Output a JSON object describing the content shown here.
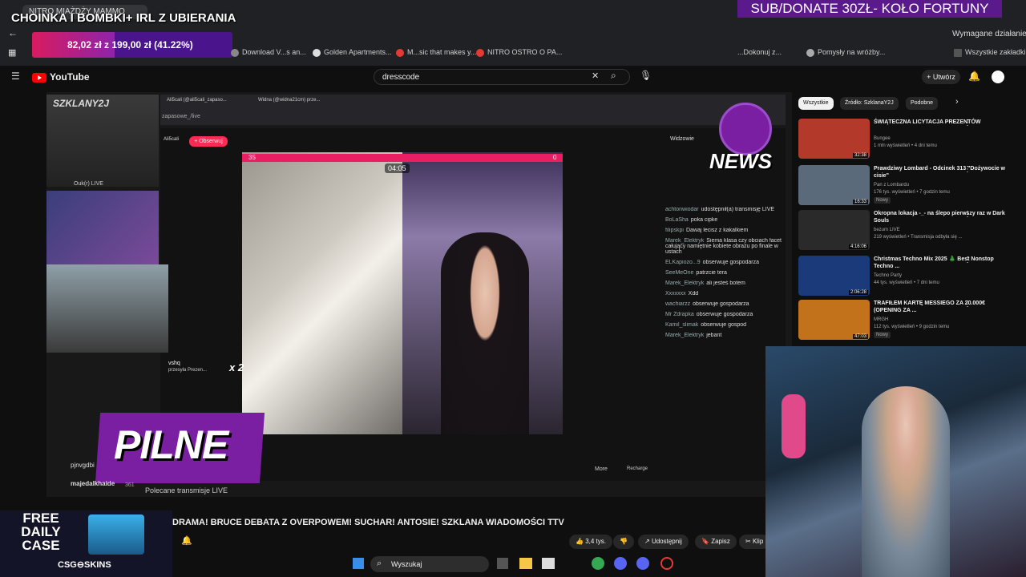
{
  "overlay": {
    "title": "CHOINKA I BOMBKI+ IRL Z UBIERANIA",
    "donate": "SUB/DONATE 30ZŁ- KOŁO FORTUNY",
    "goal": "82,02 zł z 199,00 zł (41.22%)",
    "goal_fraction": 0.4122
  },
  "browser": {
    "tabs": [
      "NITRO MIAŻDŻY MAMMO",
      "Wymagane działanie"
    ],
    "bookmarks": [
      "Download V...s an...",
      "Golden Apartments...",
      "M...sic that makes y...",
      "NITRO OSTRO O PA...",
      "...Dokonuj z...",
      "Pomysły na wróżby...",
      "Wszystkie zakładki"
    ]
  },
  "youtube": {
    "logo": "YouTube",
    "search_value": "dresscode",
    "create": "Utwórz",
    "video_title": "DRAMA! BRUCE DEBATA Z OVERPOWEM! SUCHAR! ANTOSIE! SZKLANA WIADOMOŚCI TTV",
    "recommended_label": "Polecane transmisje LIVE",
    "likes": "3,4 tys.",
    "share": "Udostępnij",
    "save": "Zapisz",
    "clip": "Klip"
  },
  "stream": {
    "tab1": "Ali5cali (@ali5cali_zapaso...",
    "tab2": "Widna (@widna21cm) prze...",
    "url": "zapasowe_/live",
    "streamer": "Ali5cali",
    "follow": "+ Obserwuj",
    "timer": "04:05",
    "score_left": "35",
    "score_right": "0",
    "gift_user": "vshq",
    "gift_text": "przesyła Prezen...",
    "gift_count": "x 2",
    "more": "More",
    "recharge": "Recharge",
    "viewers_label": "Widzowie"
  },
  "chat": [
    {
      "user": "achtonwiodar",
      "text": "udostępnił(a) transmisję LIVE"
    },
    {
      "user": "BoLaSha",
      "text": "poka cipke"
    },
    {
      "user": "filipskpi",
      "text": "Dawaj lecisz z kakalkiem"
    },
    {
      "user": "Marek_Elektryk",
      "text": "Siema klasa czy obciach facet całujący namiętnie kobiete obrazu po finale w ustach"
    },
    {
      "user": "ELKapiozo...9",
      "text": "obserwuje gospodarza"
    },
    {
      "user": "SeeMeOne",
      "text": "patrzcie tera"
    },
    {
      "user": "Marek_Elektryk",
      "text": "ali jesteś botem"
    },
    {
      "user": "Xxxxxxx",
      "text": "Xdd"
    },
    {
      "user": "wachiarzz",
      "text": "obserwuje gospodarza"
    },
    {
      "user": "Mr Zdrapka",
      "text": "obserwuje gospodarza"
    },
    {
      "user": "Kamil_slimak",
      "text": "obserwuje gospod"
    },
    {
      "user": "Marek_Elektryk",
      "text": "jebant"
    }
  ],
  "overlays": {
    "pilne": "PILNE",
    "news": "NEWS",
    "cam_label": "SZKLANY2J",
    "cam_sub": "Ouk(r) LIVE",
    "csgo_free": "FREE DAILY CASE",
    "csgo_brand": "CSG⊖SKINS",
    "user1": "pjnvgdbi",
    "user2": "majedalkhaide",
    "user2_count": "361"
  },
  "sidebar": {
    "chips": [
      "Wszystkie",
      "Źródło: SzklanaY2J",
      "Podobne"
    ],
    "items": [
      {
        "title": "ŚWIĄTECZNA LICYTACJA PREZENTÓW",
        "channel": "Bungee",
        "meta": "1 mln wyświetleń • 4 dni temu",
        "duration": "32:38",
        "badge": "",
        "color": "#b33a2a"
      },
      {
        "title": "Prawdziwy Lombard - Odcinek 313 \"Dożywocie w cisie\"",
        "channel": "Pan z Lombardu",
        "meta": "176 tys. wyświetleń • 7 godzin temu",
        "duration": "16:33",
        "badge": "Nowy",
        "color": "#5a6a7a"
      },
      {
        "title": "Okropna lokacja -_- na ślepo pierwszy raz w Dark Souls",
        "channel": "bezum LIVE",
        "meta": "219 wyświetleń • Transmisja odbyła się ...",
        "duration": "4:16:06",
        "badge": "",
        "color": "#2a2a2a"
      },
      {
        "title": "Christmas Techno Mix 2025 🎄 Best Nonstop Techno ...",
        "channel": "Techno Party",
        "meta": "44 tys. wyświetleń • 7 dni temu",
        "duration": "2:06:28",
        "badge": "",
        "color": "#1a3a7a"
      },
      {
        "title": "TRAFIŁEM KARTĘ MESSIEGO ZA 20.000€ (OPENING ZA ...",
        "channel": "MRGH",
        "meta": "112 tys. wyświetleń • 9 godzin temu",
        "duration": "47:03",
        "badge": "Nowy",
        "color": "#c2721a"
      }
    ]
  },
  "taskbar": {
    "search": "Wyszukaj"
  }
}
